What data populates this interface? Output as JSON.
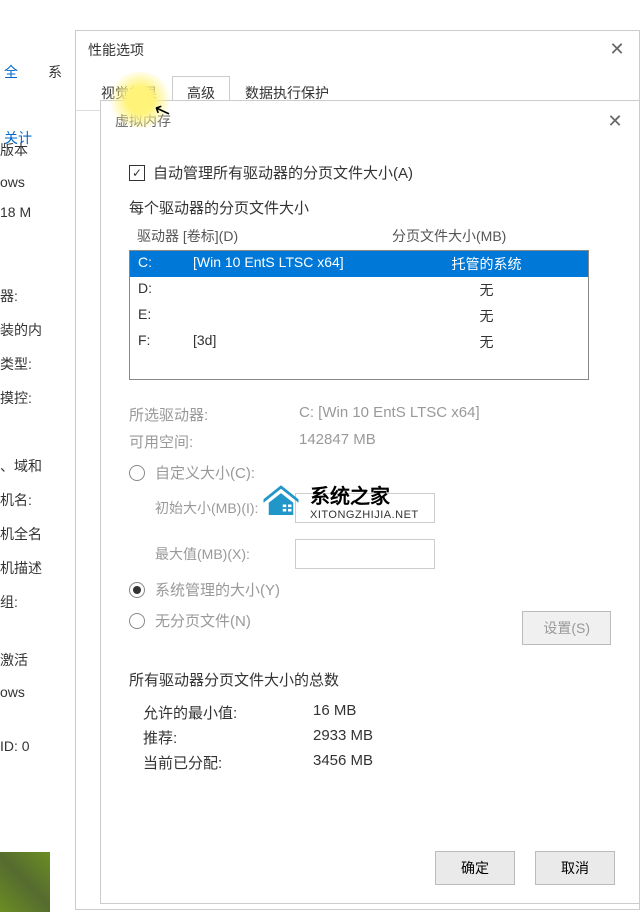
{
  "bg": {
    "addr_crumb1": "全",
    "addr_sep": "›",
    "addr_crumb2": "系",
    "link": "关计",
    "side_labels": [
      "版本",
      "ows",
      "18 M",
      "器:",
      "装的内",
      "类型:",
      "摸控:",
      "、域和",
      "机名:",
      "机全名",
      "机描述",
      "组:",
      "激活",
      "ows",
      "ID: 0"
    ]
  },
  "win1": {
    "title": "性能选项",
    "tabs": [
      "视觉效果",
      "高级",
      "数据执行保护"
    ]
  },
  "win2": {
    "title": "虚拟内存",
    "auto_manage": "自动管理所有驱动器的分页文件大小(A)",
    "each_drive": "每个驱动器的分页文件大小",
    "header_drive": "驱动器 [卷标](D)",
    "header_pf": "分页文件大小(MB)",
    "drives": [
      {
        "letter": "C:",
        "label": "[Win 10 EntS LTSC x64]",
        "pf": "托管的系统",
        "selected": true
      },
      {
        "letter": "D:",
        "label": "",
        "pf": "无",
        "selected": false
      },
      {
        "letter": "E:",
        "label": "",
        "pf": "无",
        "selected": false
      },
      {
        "letter": "F:",
        "label": "[3d]",
        "pf": "无",
        "selected": false
      }
    ],
    "selected_drive_label": "所选驱动器:",
    "selected_drive_value": "C:  [Win 10 EntS LTSC x64]",
    "free_space_label": "可用空间:",
    "free_space_value": "142847 MB",
    "custom_size": "自定义大小(C):",
    "initial_size": "初始大小(MB)(I):",
    "max_size": "最大值(MB)(X):",
    "system_managed": "系统管理的大小(Y)",
    "no_paging": "无分页文件(N)",
    "set_btn": "设置(S)",
    "totals_title": "所有驱动器分页文件大小的总数",
    "min_allowed_label": "允许的最小值:",
    "min_allowed_value": "16 MB",
    "recommended_label": "推荐:",
    "recommended_value": "2933 MB",
    "allocated_label": "当前已分配:",
    "allocated_value": "3456 MB",
    "ok": "确定",
    "cancel": "取消"
  },
  "watermark": {
    "name": "系统之家",
    "url": "XITONGZHIJIA.NET"
  }
}
